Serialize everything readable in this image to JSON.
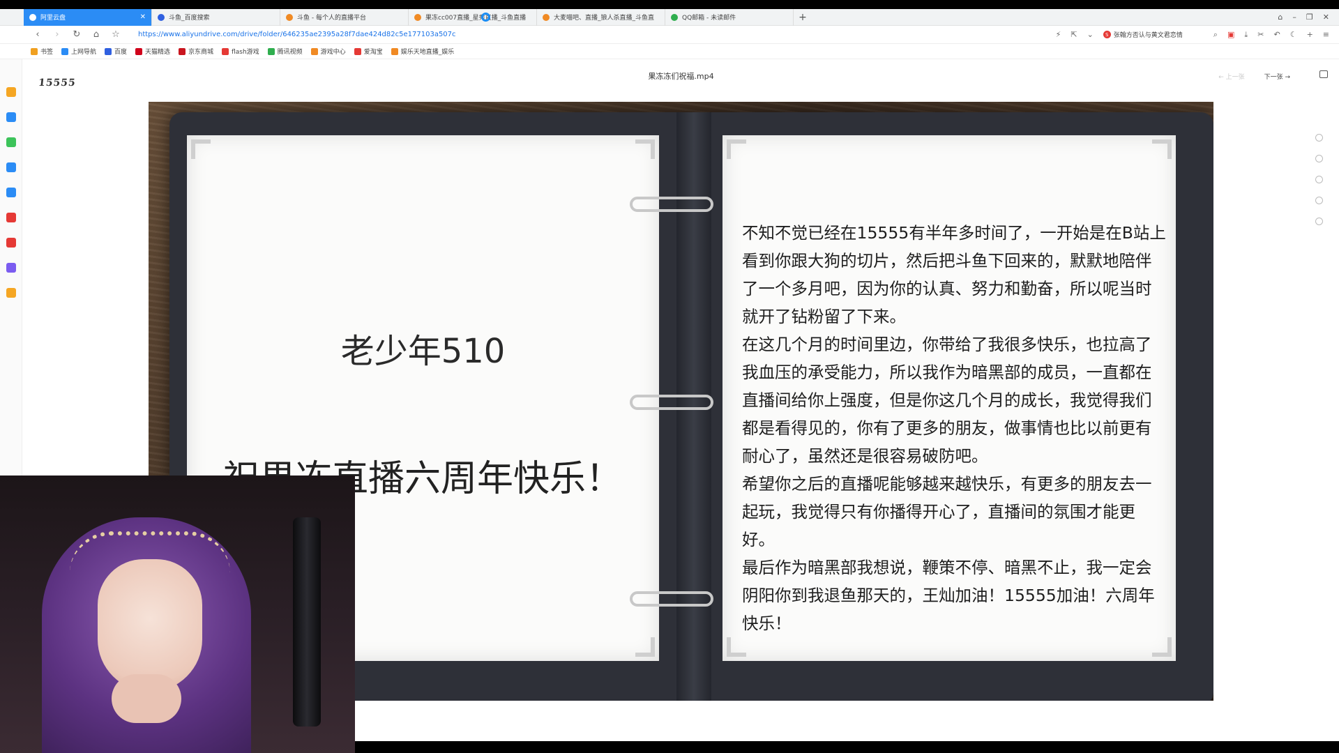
{
  "browser": {
    "tabs": [
      {
        "label": "阿里云盘",
        "active": true,
        "icon_color": "#ffffff"
      },
      {
        "label": "斗鱼_百度搜索",
        "active": false,
        "icon_color": "#3060e0"
      },
      {
        "label": "斗鱼 - 每个人的直播平台",
        "active": false,
        "icon_color": "#f08a24"
      },
      {
        "label": "果冻cc007直播_星秀直播_斗鱼直播",
        "active": false,
        "icon_color": "#f08a24"
      },
      {
        "label": "大麦喵吧、直播_狼人杀直播_斗鱼直",
        "active": false,
        "icon_color": "#f08a24"
      },
      {
        "label": "QQ邮箱 - 未读邮件",
        "active": false,
        "icon_color": "#2fae4e"
      }
    ],
    "new_tab_label": "+",
    "url": "https://www.aliyundrive.com/drive/folder/646235ae2395a28f7dae424d82c5e177103a507c",
    "search_suggest": "张翰方否认与黄文君恋情",
    "bookmarks": [
      {
        "label": "书签",
        "icon_color": "#f0a020"
      },
      {
        "label": "上网导航",
        "icon_color": "#2b8cf5"
      },
      {
        "label": "百度",
        "icon_color": "#3060e0"
      },
      {
        "label": "天猫精选",
        "icon_color": "#d0021b"
      },
      {
        "label": "京东商城",
        "icon_color": "#c9151e"
      },
      {
        "label": "flash游戏",
        "icon_color": "#e53935"
      },
      {
        "label": "腾讯视频",
        "icon_color": "#2fae4e"
      },
      {
        "label": "游戏中心",
        "icon_color": "#f08a24"
      },
      {
        "label": "爱淘宝",
        "icon_color": "#e53935"
      },
      {
        "label": "娱乐天地直播_娱乐",
        "icon_color": "#f08a24"
      }
    ]
  },
  "left_rail": {
    "icons": [
      "star-icon",
      "clock-icon",
      "chat-icon",
      "plane-icon",
      "game-icon",
      "camera-icon",
      "pdf-icon",
      "edit-icon",
      "search-icon"
    ],
    "colors": [
      "#f5a623",
      "#2b8cf5",
      "#3cc35a",
      "#2b8cf5",
      "#2b8cf5",
      "#e53935",
      "#e53935",
      "#7b5cf0",
      "#f5a623"
    ]
  },
  "viewer": {
    "logo_text": "15555",
    "file_title": "果冻冻们祝福.mp4",
    "prev_label": "← 上一张",
    "next_label": "下一张 →"
  },
  "video": {
    "left_page": {
      "name": "老少年510",
      "greeting": "祝果冻直播六周年快乐！"
    },
    "right_page": {
      "paragraphs": [
        "不知不觉已经在15555有半年多时间了，一开始是在B站上看到你跟大狗的切片，然后把斗鱼下回来的，默默地陪伴了一个多月吧，因为你的认真、努力和勤奋，所以呢当时就开了钻粉留了下来。",
        "在这几个月的时间里边，你带给了我很多快乐，也拉高了我血压的承受能力，所以我作为暗黑部的成员，一直都在直播间给你上强度，但是你这几个月的成长，我觉得我们都是看得见的，你有了更多的朋友，做事情也比以前更有耐心了，虽然还是很容易破防吧。",
        "希望你之后的直播呢能够越来越快乐，有更多的朋友去一起玩，我觉得只有你播得开心了，直播间的氛围才能更好。",
        "最后作为暗黑部我想说，鞭策不停、暗黑不止，我一定会阴阳你到我退鱼那天的，王灿加油！15555加油！六周年快乐！"
      ]
    }
  }
}
